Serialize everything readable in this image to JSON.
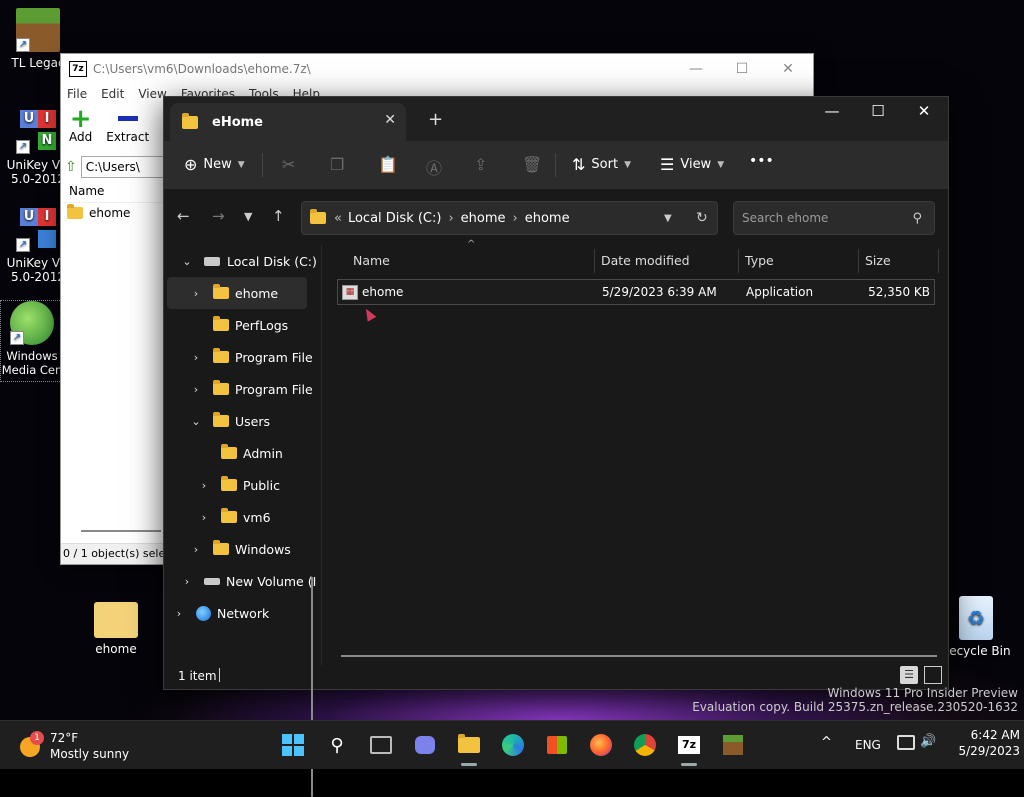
{
  "desktop": {
    "icons": [
      {
        "label": "TL Legac"
      },
      {
        "label": "UniKey Vis 5.0-2012"
      },
      {
        "label": "UniKey Vis 5.0-2012"
      },
      {
        "label": "Windows Media Cen"
      },
      {
        "label": "ehome"
      },
      {
        "label": "Recycle Bin"
      }
    ],
    "watermark_line1": "Windows 11 Pro Insider Preview",
    "watermark_line2": "Evaluation copy. Build 25375.zn_release.230520-1632"
  },
  "sevenzip": {
    "title": "C:\\Users\\vm6\\Downloads\\ehome.7z\\",
    "menu": [
      "File",
      "Edit",
      "View",
      "Favorites",
      "Tools",
      "Help"
    ],
    "tools": [
      {
        "label": "Add"
      },
      {
        "label": "Extract"
      },
      {
        "label": "T"
      }
    ],
    "address": "C:\\Users\\",
    "column_name": "Name",
    "row_name": "ehome",
    "status": "0 / 1 object(s) selec"
  },
  "explorer": {
    "tab_title": "eHome",
    "new_tab": "+",
    "cmd": {
      "new": "New",
      "sort": "Sort",
      "view": "View",
      "more": "•••"
    },
    "breadcrumb": {
      "sep": "«",
      "root": "Local Disk (C:)",
      "p1": "ehome",
      "p2": "ehome"
    },
    "search_placeholder": "Search ehome",
    "nav": [
      {
        "label": "Local Disk (C:)"
      },
      {
        "label": "ehome"
      },
      {
        "label": "PerfLogs"
      },
      {
        "label": "Program File"
      },
      {
        "label": "Program File"
      },
      {
        "label": "Users"
      },
      {
        "label": "Admin"
      },
      {
        "label": "Public"
      },
      {
        "label": "vm6"
      },
      {
        "label": "Windows"
      },
      {
        "label": "New Volume (I"
      },
      {
        "label": "Network"
      }
    ],
    "columns": {
      "name": "Name",
      "date": "Date modified",
      "type": "Type",
      "size": "Size"
    },
    "files": [
      {
        "name": "ehome",
        "date": "5/29/2023 6:39 AM",
        "type": "Application",
        "size": "52,350 KB"
      }
    ],
    "status": "1 item"
  },
  "taskbar": {
    "weather_temp": "72°F",
    "weather_desc": "Mostly sunny",
    "weather_badge": "1",
    "lang": "ENG",
    "time": "6:42 AM",
    "date": "5/29/2023",
    "sevenzip_label": "7z"
  }
}
